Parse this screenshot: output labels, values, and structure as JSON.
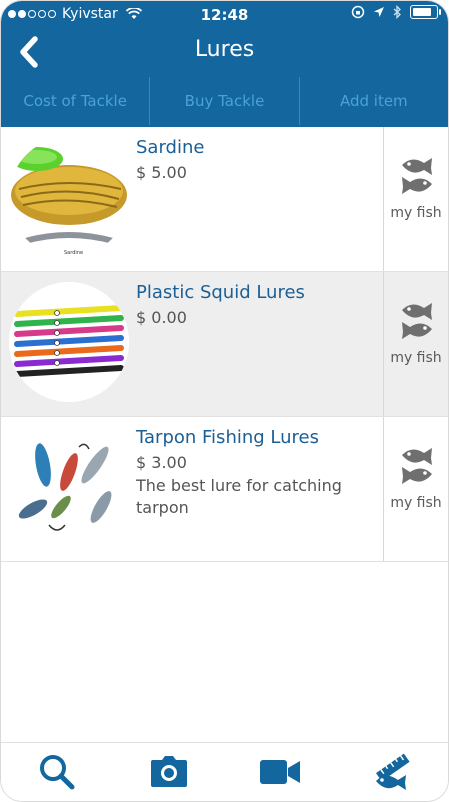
{
  "status_bar": {
    "carrier": "Kyivstar",
    "time": "12:48"
  },
  "navbar": {
    "title": "Lures"
  },
  "tabs": [
    {
      "label": "Cost of Tackle"
    },
    {
      "label": "Buy Tackle"
    },
    {
      "label": "Add item"
    }
  ],
  "items": [
    {
      "name": "Sardine",
      "price": "$ 5.00",
      "description": "",
      "action_label": "my fish",
      "image": "sardine-jar"
    },
    {
      "name": "Plastic Squid Lures",
      "price": "$ 0.00",
      "description": "",
      "action_label": "my fish",
      "image": "squid-lures"
    },
    {
      "name": "Tarpon Fishing Lures",
      "price": "$ 3.00",
      "description": "The best lure  for catching tarpon",
      "action_label": "my fish",
      "image": "tarpon-lures"
    }
  ],
  "bottom_tabs": [
    {
      "icon": "search-icon"
    },
    {
      "icon": "camera-icon"
    },
    {
      "icon": "video-icon"
    },
    {
      "icon": "fish-ruler-icon"
    }
  ],
  "colors": {
    "primary": "#13669e",
    "tab_text": "#4aa3d6",
    "title_text": "#1b5f96",
    "muted_text": "#555555"
  }
}
